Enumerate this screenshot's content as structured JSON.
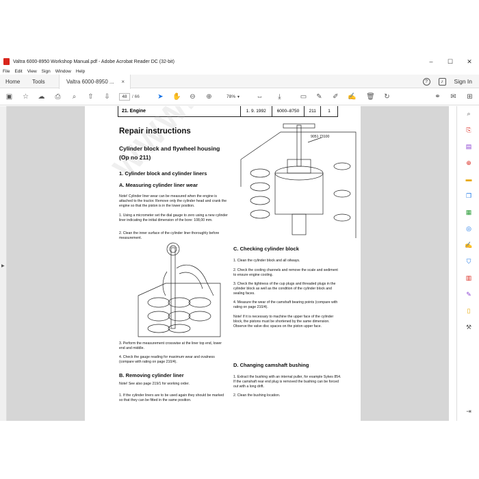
{
  "window": {
    "title": "Valtra 6000-8950 Workshop Manual.pdf - Adobe Acrobat Reader DC (32-bit)",
    "controls": [
      "–",
      "☐",
      "✕"
    ]
  },
  "menu": [
    "File",
    "Edit",
    "View",
    "Sign",
    "Window",
    "Help"
  ],
  "tabs": {
    "home": "Home",
    "tools": "Tools",
    "doc": "Valtra 6000-8950 ...",
    "doc_close": "×",
    "signin": "Sign In"
  },
  "toolbar": {
    "page_current": "48",
    "page_total": "/ 66",
    "zoom": "78%"
  },
  "document": {
    "header": {
      "section": "21. Engine",
      "date": "1. 9. 1992",
      "model": "6000–8750",
      "code": "211",
      "page": "1"
    },
    "title": "Repair instructions",
    "subtitle_line1": "Cylinder block and flywheel housing",
    "subtitle_line2": "(Op no 211)",
    "s1_heading": "1. Cylinder block and cylinder liners",
    "sA_heading": "A. Measuring cylinder liner wear",
    "sA_note": "Note! Cylinder liner wear can be measured  when the engine is attached to the tractor. Remove only the cylinder head and crank the engine so that the piston is in the lower position.",
    "sA_step1": "1. Using a micrometer set the dial gauge to zero using a new cylinder liner indicating the initial dimension of the bore: 108,00 mm.",
    "sA_step2": "2. Clean the inner surface of the cylinder liner thoroughly before measurement.",
    "sA_step3": "3. Perform the measurement crosswise at the liner top end, lower end and middle.",
    "sA_step4": "4. Check the gauge reading for maximum wear and ovalness (compare with rating on page 210/4).",
    "sB_heading": "B. Removing cylinder liner",
    "sB_note": "Note! See also page 219/1 for working order.",
    "sB_step1": "1. If the cylinder liners are to be used again they should be marked so that they can be fitted in the same position.",
    "tool_label": "9051 73100",
    "sC_heading": "C. Checking cylinder block",
    "sC_step1": "1. Clean the cylinder block and all oilways.",
    "sC_step2": "2. Check the cooling channels and remove the scale and sediment to ensure engine cooling.",
    "sC_step3": "3. Check the tightness of the cup plugs and threaded plugs in the cylinder block as well as the condition of the cylinder block and sealing faces.",
    "sC_step4": "4. Measure the wear of the camshaft bearing points  (compare with rating on page 210/4).",
    "sC_note": "Note! If it is necessary to machine the upper face of the cylinder block, the pistons must be shortened by the same dimension. Observe the valve disc spaces on the piston upper face.",
    "sD_heading": "D. Changing camshaft bushing",
    "sD_step1": "1. Extract the bushing with an internal puller, for example Sykes 854. If the camshaft rear end plug is removed the bushing can be forced out with a long drift.",
    "sD_step2": "2. Clean the bushing location.",
    "watermark": "WWW.EPCDATO.COM"
  },
  "colors": {
    "accent": "#1473e6",
    "acrobat_red": "#d9261c",
    "canvas": "#d6d6d6"
  }
}
